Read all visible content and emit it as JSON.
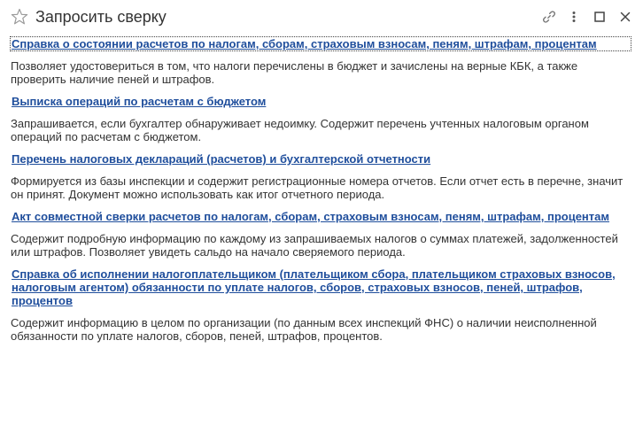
{
  "header": {
    "title": "Запросить сверку",
    "icons": [
      "star-icon",
      "link-icon",
      "more-icon",
      "maximize-icon",
      "close-icon"
    ]
  },
  "items": [
    {
      "link": "Справка о состоянии расчетов по налогам, сборам, страховым взносам, пеням, штрафам, процентам",
      "description": "Позволяет удостовериться в том, что налоги перечислены в бюджет и зачислены на верные КБК, а также проверить наличие пеней и штрафов."
    },
    {
      "link": "Выписка операций по расчетам с бюджетом",
      "description": "Запрашивается, если бухгалтер обнаруживает недоимку. Содержит перечень учтенных налоговым органом операций по расчетам с бюджетом."
    },
    {
      "link": "Перечень налоговых деклараций (расчетов) и бухгалтерской отчетности",
      "description": "Формируется из базы инспекции и содержит регистрационные номера отчетов. Если отчет есть в перечне, значит он принят. Документ можно использовать как итог отчетного периода."
    },
    {
      "link": "Акт совместной сверки расчетов по налогам, сборам, страховым взносам, пеням, штрафам, процентам",
      "description": "Содержит подробную информацию по каждому из запрашиваемых налогов о суммах платежей, задолженностей или штрафов. Позволяет увидеть сальдо на начало сверяемого периода."
    },
    {
      "link": "Справка об исполнении налогоплательщиком (плательщиком сбора, плательщиком страховых взносов, налоговым агентом) обязанности по уплате налогов, сборов, страховых взносов, пеней, штрафов, процентов",
      "description": "Содержит информацию в целом по организации (по данным всех инспекций ФНС) о наличии неисполненной обязанности по уплате налогов, сборов, пеней, штрафов, процентов."
    }
  ],
  "colors": {
    "link": "#1f4e9c",
    "text": "#333333",
    "icon": "#666666"
  }
}
